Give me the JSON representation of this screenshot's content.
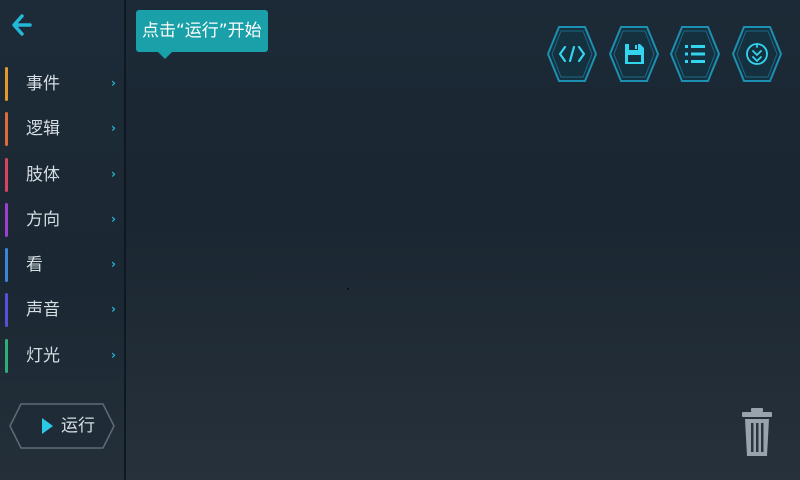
{
  "tooltip": {
    "text": "点击“运行”开始"
  },
  "sidebar": {
    "categories": [
      {
        "label": "事件",
        "color": "#e8972e"
      },
      {
        "label": "逻辑",
        "color": "#e06a3a"
      },
      {
        "label": "肢体",
        "color": "#d64560"
      },
      {
        "label": "方向",
        "color": "#9a3fd0"
      },
      {
        "label": "看",
        "color": "#3d86d6"
      },
      {
        "label": "声音",
        "color": "#5b4fd8"
      },
      {
        "label": "灯光",
        "color": "#2fae7a"
      }
    ],
    "chevron": "›",
    "run_label": "运行"
  },
  "toolbar": {
    "buttons": [
      {
        "icon": "code-icon"
      },
      {
        "icon": "save-icon"
      },
      {
        "icon": "list-icon"
      },
      {
        "icon": "sensor-icon"
      }
    ]
  },
  "colors": {
    "accent": "#22b8d6",
    "tooltip_bg": "#1aa0a8",
    "background": "#1c2a37"
  }
}
